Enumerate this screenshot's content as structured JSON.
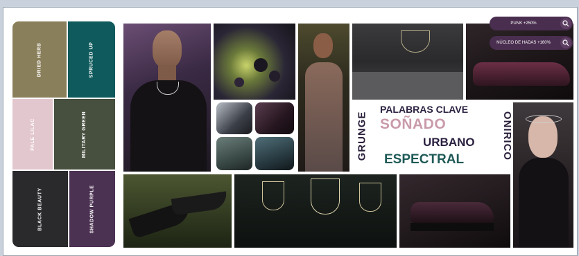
{
  "palette": [
    {
      "name": "DRIED HERB",
      "color": "#8a7f5b"
    },
    {
      "name": "SPRUCED UP",
      "color": "#0f5a5c"
    },
    {
      "name": "PALE LILAC",
      "color": "#e3c7cf"
    },
    {
      "name": "MILITARY GREEN",
      "color": "#474f3e"
    },
    {
      "name": "BLACK BEAUTY",
      "color": "#2a2a2d"
    },
    {
      "name": "SHADOW PURPLE",
      "color": "#4b3152"
    }
  ],
  "keywords": {
    "heading": "PALABRAS CLAVE",
    "w1": "SOÑADO",
    "w2": "URBANO",
    "w3": "ESPECTRAL",
    "left_vertical": "GRUNGE",
    "right_vertical": "ONIRICO",
    "colors": {
      "heading": "#2b2140",
      "w1": "#c99aaa",
      "w2": "#2b2140",
      "w3": "#1f5a57"
    }
  },
  "pills": [
    {
      "label": "PUNK +250%"
    },
    {
      "label": "NÚCLEO DE HADAS +160%"
    }
  ],
  "icons": {
    "search": "search-icon"
  }
}
